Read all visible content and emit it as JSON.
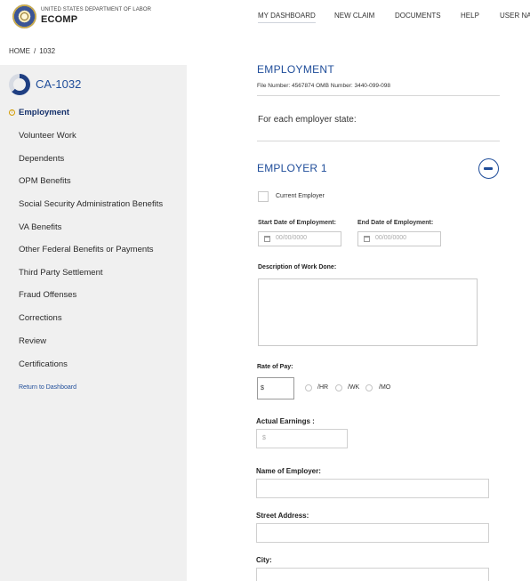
{
  "header": {
    "agency": "UNITED STATES DEPARTMENT OF LABOR",
    "app_name": "ECOMP",
    "nav": [
      "MY DASHBOARD",
      "NEW CLAIM",
      "DOCUMENTS",
      "HELP",
      "USER NAI"
    ]
  },
  "breadcrumb": {
    "home": "HOME",
    "sep": "/",
    "current": "1032"
  },
  "sidebar": {
    "form_id": "CA-1032",
    "progress": 0.63,
    "items": [
      "Employment",
      "Volunteer Work",
      "Dependents",
      "OPM Benefits",
      "Social Security Administration Benefits",
      "VA Benefits",
      "Other Federal Benefits or Payments",
      "Third Party Settlement",
      "Fraud Offenses",
      "Corrections",
      "Review",
      "Certifications"
    ],
    "warning_icon": "!",
    "return_link": "Return to Dashboard"
  },
  "main": {
    "title": "EMPLOYMENT",
    "file_line": "File Number: 4567874   OMB Number: 3440-099-098",
    "state_prompt": "For each employer state:",
    "employer_title": "EMPLOYER 1",
    "current_employer_label": "Current Employer",
    "start_date_label": "Start Date of Employment:",
    "end_date_label": "End Date of Employment:",
    "date_placeholder": "00/00/0000",
    "description_label": "Description of Work Done:",
    "rate_label": "Rate of Pay:",
    "rate_prefix": "$",
    "rate_options": [
      "/HR",
      "/WK",
      "/MO"
    ],
    "earnings_label": "Actual Earnings  :",
    "earnings_placeholder": "$",
    "employer_name_label": "Name of Employer:",
    "street_label": "Street Address:",
    "city_label": "City:"
  }
}
